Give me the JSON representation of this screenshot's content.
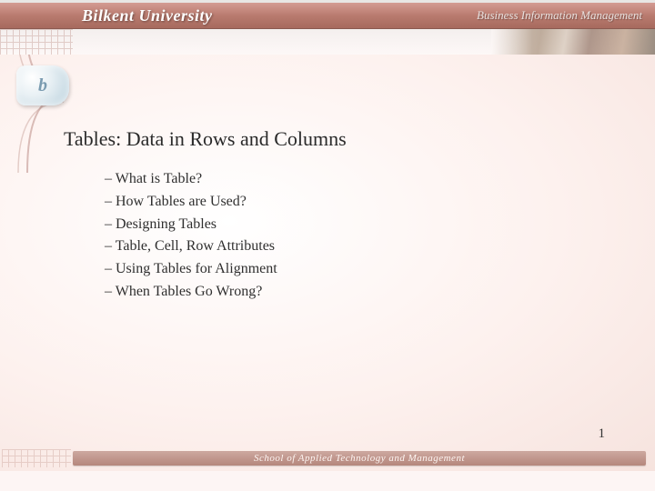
{
  "header": {
    "institution": "Bilkent University",
    "department": "Business Information Management"
  },
  "logo": {
    "text": "b"
  },
  "slide": {
    "title": "Tables: Data in Rows and Columns",
    "bullets": [
      "What is Table?",
      "How Tables are Used?",
      "Designing Tables",
      "Table, Cell, Row Attributes",
      "Using Tables for Alignment",
      "When Tables Go Wrong?"
    ],
    "page_number": "1"
  },
  "footer": {
    "school": "School of Applied Technology and Management"
  }
}
